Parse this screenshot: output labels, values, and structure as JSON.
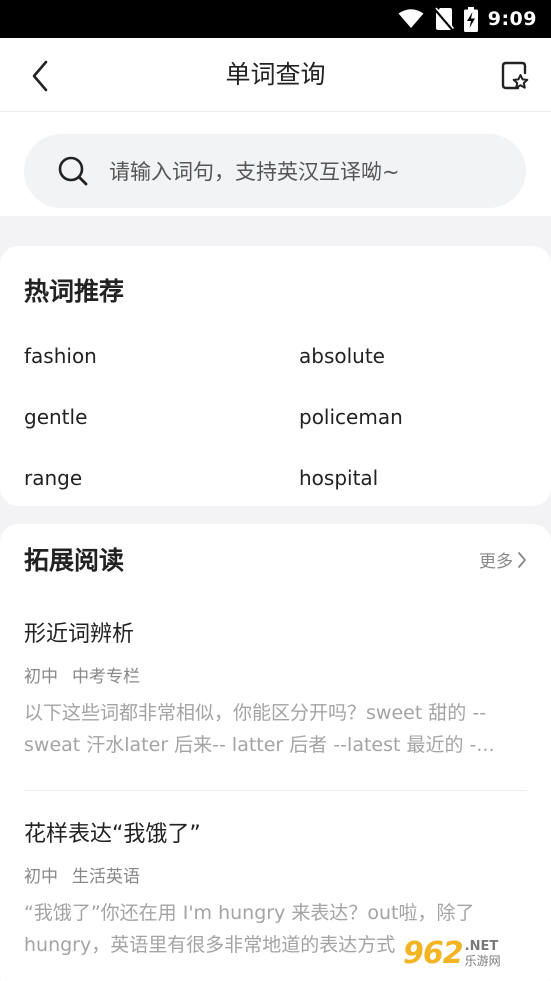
{
  "status_bar": {
    "time": "9:09"
  },
  "header": {
    "title": "单词查询"
  },
  "search": {
    "placeholder": "请输入词句，支持英汉互译呦~"
  },
  "hot_words": {
    "title": "热词推荐",
    "items": [
      "fashion",
      "absolute",
      "gentle",
      "policeman",
      "range",
      "hospital"
    ]
  },
  "extended_reading": {
    "title": "拓展阅读",
    "more_label": "更多",
    "articles": [
      {
        "title": "形近词辨析",
        "tags": [
          "初中",
          "中考专栏"
        ],
        "summary": "以下这些词都非常相似，你能区分开吗？sweet 甜的 -- sweat 汗水later 后来-- latter 后者 --latest 最近的 -..."
      },
      {
        "title": "花样表达“我饿了”",
        "tags": [
          "初中",
          "生活英语"
        ],
        "summary": "“我饿了”你还在用 I'm hungry 来表达？out啦，除了 hungry，英语里有很多非常地道的表达方式"
      }
    ]
  },
  "watermark": {
    "logo": "962",
    "net": ".NET",
    "cn": "乐游网"
  }
}
